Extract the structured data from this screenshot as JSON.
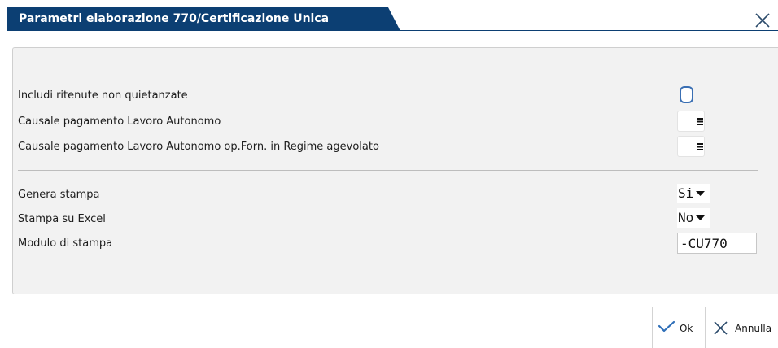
{
  "dialog": {
    "title": "Parametri elaborazione 770/Certificazione Unica"
  },
  "fields": {
    "includi_ritenute": {
      "label": "Includi ritenute non quietanzate",
      "checked": false
    },
    "causale_lavoro_autonomo": {
      "label": "Causale pagamento Lavoro Autonomo",
      "value": ""
    },
    "causale_regime_agevolato": {
      "label": "Causale pagamento Lavoro Autonomo op.Forn. in Regime agevolato",
      "value": ""
    },
    "genera_stampa": {
      "label": "Genera stampa",
      "value": "Si"
    },
    "stampa_excel": {
      "label": "Stampa su Excel",
      "value": "No"
    },
    "modulo_stampa": {
      "label": "Modulo di stampa",
      "value": "-CU770"
    }
  },
  "actions": {
    "ok_label": "Ok",
    "cancel_label": "Annulla"
  },
  "colors": {
    "title_bar": "#0c3f73",
    "panel_bg": "#f2f2f2",
    "checkbox_border": "#3a6fb3",
    "ok_icon": "#2f6fb8"
  },
  "icons": {
    "close": "close-icon",
    "lookup": "menu-lines-icon",
    "dropdown": "caret-down-icon",
    "ok": "checkmark-icon",
    "cancel": "x-icon"
  }
}
